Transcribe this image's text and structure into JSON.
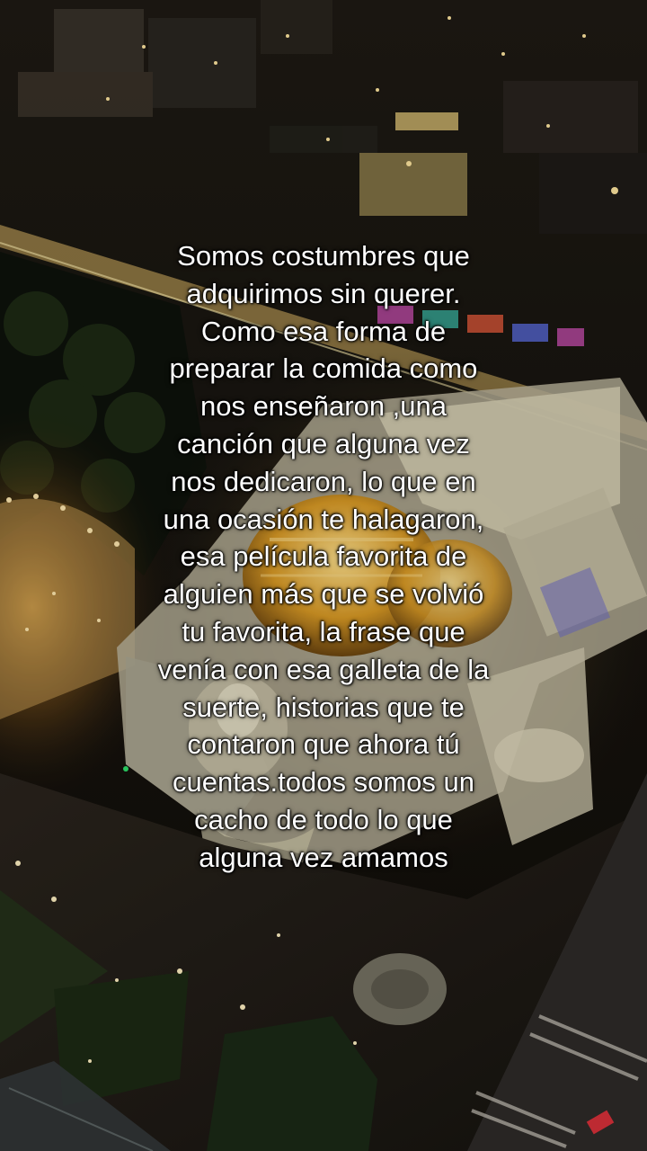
{
  "caption": {
    "lines": [
      "Somos costumbres que",
      "adquirimos sin querer.",
      "Como esa forma de",
      "preparar la comida como",
      "nos enseñaron ,una",
      "canción que alguna vez",
      "nos dedicaron, lo que en",
      "una ocasión te halagaron,",
      "esa película favorita de",
      "alguien más que se volvió",
      "tu favorita, la frase que",
      "venía con esa galleta de la",
      "suerte, historias que te",
      "contaron que ahora tú",
      "cuentas.todos somos un",
      "cacho de todo lo que",
      "alguna vez amamos"
    ]
  },
  "colors": {
    "night_sky": "#100d09",
    "city_glow": "#f2c14e",
    "dome_gold": "#e0a42a",
    "palace_facade": "#d9d4c4",
    "caption_text": "#ffffff"
  }
}
